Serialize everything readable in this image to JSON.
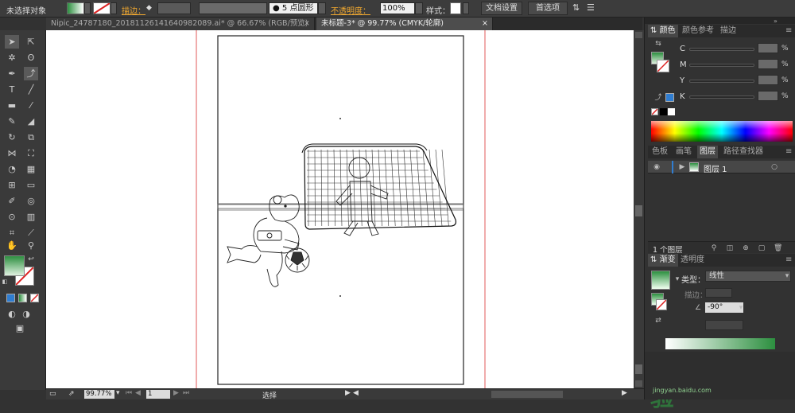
{
  "control_bar": {
    "selection_status": "未选择对象",
    "stroke_label": "描边：",
    "stroke_width_arrows": "◆",
    "brush_point": "5",
    "brush_shape": "点圆形",
    "opacity_label": "不透明度：",
    "opacity_value": "100%",
    "style_label": "样式：",
    "doc_setup_button": "文档设置",
    "preferences_button": "首选项"
  },
  "doc_tabs": [
    {
      "label": "Nipic_24787180_20181126141640982089.ai* @ 66.67% (RGB/预览)"
    },
    {
      "label": "未标题-3* @ 99.77% (CMYK/轮廓)"
    }
  ],
  "close_glyph": "×",
  "status_bar": {
    "zoom": "99.77%",
    "page": "1",
    "mode": "选择"
  },
  "color_panel": {
    "tabs": [
      "颜色",
      "颜色参考",
      "描边"
    ],
    "channels": [
      {
        "label": "C"
      },
      {
        "label": "M"
      },
      {
        "label": "Y"
      },
      {
        "label": "K"
      }
    ],
    "percent_sign": "%"
  },
  "layers_panel": {
    "tabs": [
      "色板",
      "画笔",
      "图层",
      "路径查找器"
    ],
    "layer_name": "图层 1",
    "footer_count": "1 个图层"
  },
  "gradient_panel": {
    "tabs": [
      "渐变",
      "透明度"
    ],
    "type_label": "类型：",
    "type_value": "线性",
    "stroke_label": "描边：",
    "angle_value": "-90°"
  },
  "watermark": {
    "text": "经验",
    "site_tag": "jingyan.baidu.com"
  },
  "colors": {
    "gradient_start": "#2c8f3f",
    "gradient_end": "#ffffff",
    "accent_blue": "#2f7dd1",
    "guide_red": "#e05a5a"
  }
}
